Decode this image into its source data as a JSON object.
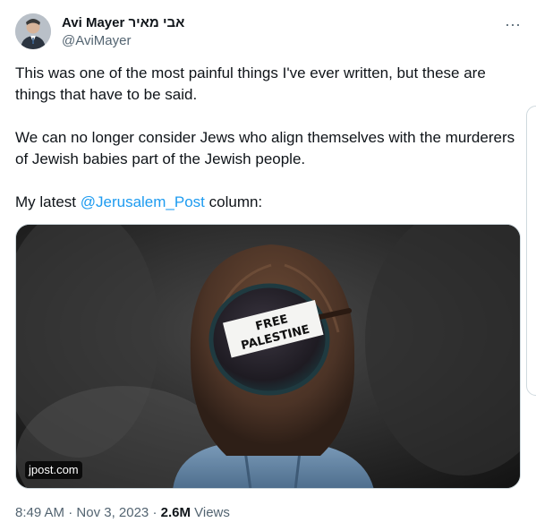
{
  "author": {
    "name": "Avi Mayer אבי מאיר",
    "handle": "@AviMayer"
  },
  "tweet": {
    "paragraph1": "This was one of the most painful things I've ever written, but these are things that have to be said.",
    "paragraph2": "We can no longer consider Jews who align themselves with the murderers of Jewish babies part of the Jewish people.",
    "paragraph3_prefix": "My latest ",
    "paragraph3_mention": "@Jerusalem_Post",
    "paragraph3_suffix": " column:"
  },
  "media": {
    "sign_line1": "FREE",
    "sign_line2": "PALESTINE",
    "source": "jpost.com"
  },
  "meta": {
    "time": "8:49 AM",
    "separator": " · ",
    "date": "Nov 3, 2023",
    "views_count": "2.6M",
    "views_label": " Views"
  },
  "icons": {
    "more": "more-horizontal-icon"
  },
  "colors": {
    "link": "#1d9bf0",
    "secondary_text": "#536471",
    "primary_text": "#0f1419"
  }
}
